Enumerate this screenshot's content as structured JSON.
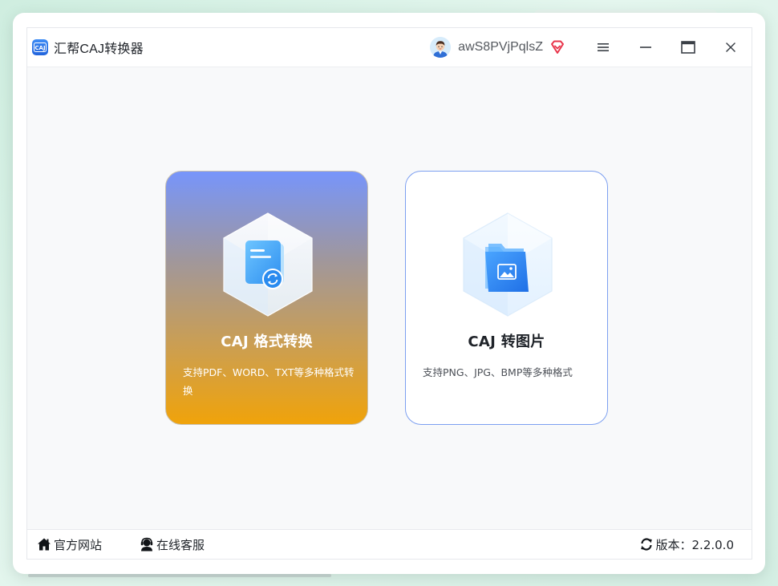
{
  "window": {
    "title": "汇帮CAJ转换器",
    "logo_text": "CAJ"
  },
  "user": {
    "name": "awS8PVjPqlsZ",
    "badge_icon": "vip-diamond-icon"
  },
  "controls": {
    "menu_icon": "menu-icon",
    "minimize_icon": "minimize-icon",
    "maximize_icon": "maximize-icon",
    "close_icon": "close-icon"
  },
  "cards": [
    {
      "title": "CAJ 格式转换",
      "desc": "支持PDF、WORD、TXT等多种格式转换",
      "icon": "document-convert-icon"
    },
    {
      "title": "CAJ 转图片",
      "desc": "支持PNG、JPG、BMP等多种格式",
      "icon": "image-folder-icon"
    }
  ],
  "footer": {
    "website": "官方网站",
    "service": "在线客服",
    "version": "版本：2.2.0.0"
  },
  "colors": {
    "accent_blue": "#2f7bf0",
    "card_gradient_top": "#7795fb",
    "card_gradient_bottom": "#f0a30a",
    "card_border_blue": "#7c9ff0",
    "vip_red": "#e8344a"
  }
}
